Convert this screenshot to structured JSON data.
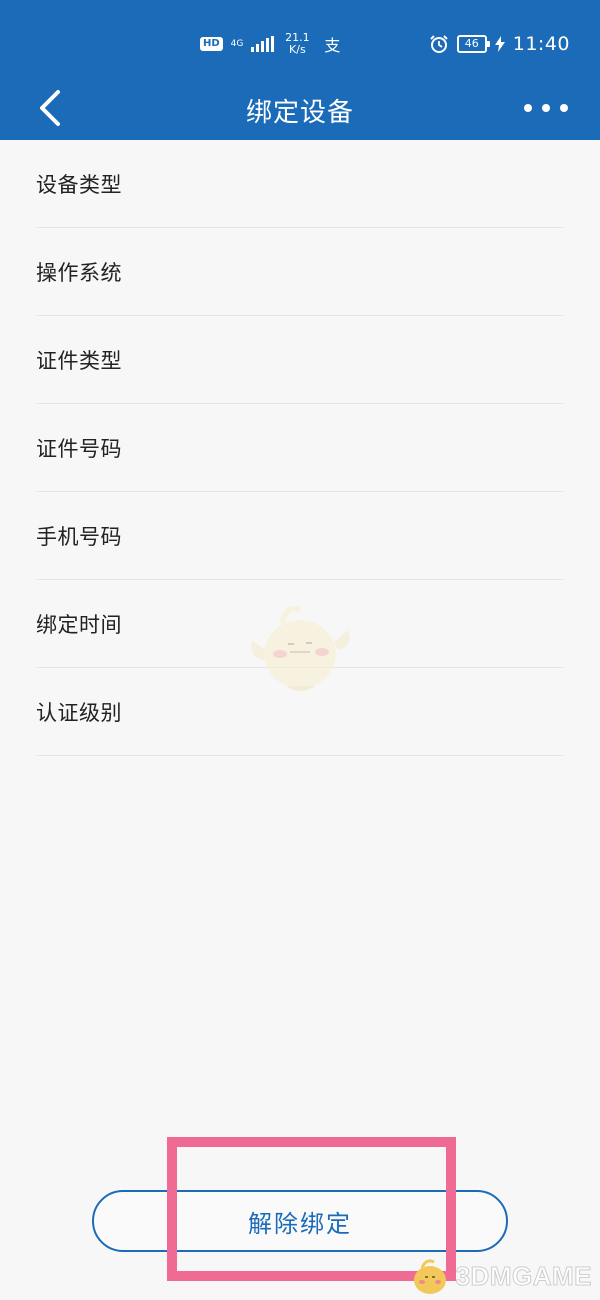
{
  "status_bar": {
    "hd": "HD",
    "network": "4G",
    "speed_value": "21.1",
    "speed_unit": "K/s",
    "pay_glyph": "支",
    "battery": "46",
    "time": "11:40"
  },
  "nav": {
    "title": "绑定设备"
  },
  "list": {
    "items": [
      {
        "label": "设备类型"
      },
      {
        "label": "操作系统"
      },
      {
        "label": "证件类型"
      },
      {
        "label": "证件号码"
      },
      {
        "label": "手机号码"
      },
      {
        "label": "绑定时间"
      },
      {
        "label": "认证级别"
      }
    ]
  },
  "actions": {
    "unbind_label": "解除绑定"
  },
  "watermark": {
    "site": "3DMGAME"
  },
  "colors": {
    "header_bg": "#1b6bb9",
    "accent": "#1b6bb9",
    "highlight": "#ef6b93",
    "page_bg": "#f7f7f7"
  }
}
